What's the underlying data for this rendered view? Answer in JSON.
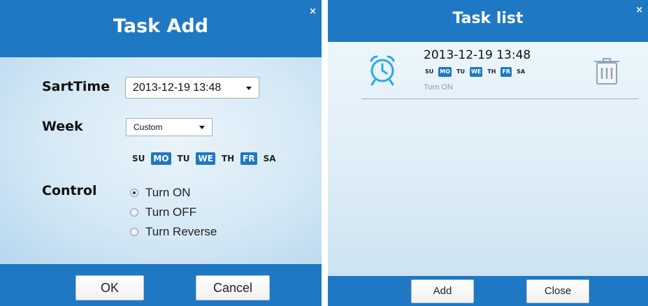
{
  "task_add": {
    "title": "Task Add",
    "close": "×",
    "start_time_label": "SartTime",
    "start_time_value": "2013-12-19 13:48",
    "week_label": "Week",
    "week_value": "Custom",
    "days": [
      {
        "label": "SU",
        "selected": false
      },
      {
        "label": "MO",
        "selected": true
      },
      {
        "label": "TU",
        "selected": false
      },
      {
        "label": "WE",
        "selected": true
      },
      {
        "label": "TH",
        "selected": false
      },
      {
        "label": "FR",
        "selected": true
      },
      {
        "label": "SA",
        "selected": false
      }
    ],
    "control_label": "Control",
    "control_options": [
      {
        "label": "Turn ON",
        "checked": true
      },
      {
        "label": "Turn OFF",
        "checked": false
      },
      {
        "label": "Turn Reverse",
        "checked": false
      }
    ],
    "ok_label": "OK",
    "cancel_label": "Cancel"
  },
  "task_list": {
    "title": "Task list",
    "close": "×",
    "items": [
      {
        "time": "2013-12-19 13:48",
        "days": [
          {
            "label": "SU",
            "selected": false
          },
          {
            "label": "MO",
            "selected": true
          },
          {
            "label": "TU",
            "selected": false
          },
          {
            "label": "WE",
            "selected": true
          },
          {
            "label": "TH",
            "selected": false
          },
          {
            "label": "FR",
            "selected": true
          },
          {
            "label": "SA",
            "selected": false
          }
        ],
        "action": "Turn ON",
        "icon": "alarm-clock-icon",
        "delete_icon": "trash-icon"
      }
    ],
    "add_label": "Add",
    "close_label": "Close"
  },
  "colors": {
    "accent": "#1f78c3",
    "selected_day": "#1f78c3",
    "clock_icon": "#29a9e6"
  }
}
